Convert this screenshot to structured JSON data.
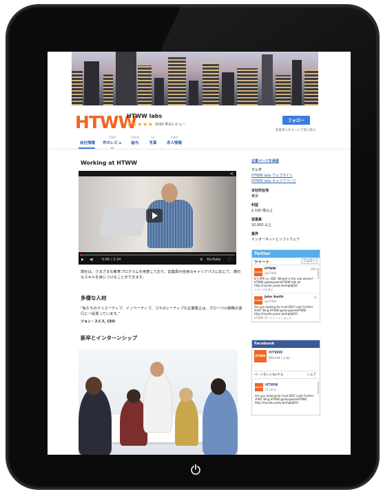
{
  "company": {
    "logo_text": "HTWW",
    "name": "HTWW labs",
    "stars": "★★★★★",
    "reviews": "5000 件のレビュー",
    "follow_label": "フォロー",
    "follow_note": "新着求人をメールで受け取る"
  },
  "tabs": [
    {
      "count": "",
      "label": "会社情報"
    },
    {
      "count": "5000",
      "label": "件のレビュー"
    },
    {
      "count": "10000",
      "label": "給与"
    },
    {
      "count": "10",
      "label": "写真"
    },
    {
      "count": "2000",
      "label": "求人情報"
    }
  ],
  "main": {
    "section_title": "Working at HTWW",
    "video_time": "0:00 / 2:24",
    "video_brand": "YouTube",
    "description": "弊社は、さまざまな教育プログラムを用意しており、従業員が自身のキャリアパスに応じて、適切なスキルを身につけることができます。",
    "diversity_title": "多様な人材",
    "quote": "“私たちのクリエーティブ、イノベーティブ、コラボレーティブな企業風土は、グローバル戦略の遂行に一役買っています。”",
    "author": "ジョン・スミス, CEO",
    "intern_title": "新卒とインターンシップ"
  },
  "sidebar": {
    "header_link": "企業ページを承認",
    "links_label": "リンク",
    "link1": "HTWW labs ウェブサイト",
    "link2": "HTWW labs キャリアページ",
    "hq_label": "本社所在地",
    "hq_value": "東京",
    "revenue_label": "利益",
    "revenue_value": "$ 100 億以上",
    "employees_label": "従業員",
    "employees_value": "10,000 以上",
    "industry_label": "業界",
    "industry_value": "インターネットとソフトウェア"
  },
  "twitter": {
    "title": "Twitter",
    "tweets_label": "ツイート",
    "follow_label": "フォロー",
    "tweet1": {
      "avatar": "HTWW",
      "name": "HTWW",
      "handle": "@HTWW",
      "time": "38m",
      "text": "It's APX vs. ADE. Whoah is the real winner? HTWW @ahoiyworkHTWW talk all http://mysite.youtu.be/hqfqB10",
      "retweet": "メディアを表示"
    },
    "tweet2": {
      "avatar": "HTWW",
      "name": "John Smith",
      "handle": "@HTWW",
      "time": "3h",
      "text": "Are you looking for trust IDX? Look Further #AET Bing HTWW @ahoiyworkHTWW http://mysite.youtu.be/hqfqB10",
      "retweet": "HTWW がリツイートしました"
    }
  },
  "facebook": {
    "title": "Facebook",
    "name": "HTWW",
    "likes": "999,144 いいね!",
    "like_label": "ページをいいね!する",
    "share_label": "シェア",
    "post": {
      "avatar": "HTWW",
      "name": "HTWW",
      "time": "21 mins",
      "text": "Are you looking for trust IDX? Look Further #AET Bing HTWW @ahoiyworkHTWW http://mysite.youtu.be/hqfqB10"
    }
  },
  "colors": {
    "brand": "#f26522",
    "link": "#2a5fa8",
    "button": "#3c7ddc",
    "twitter": "#55acee",
    "facebook": "#3b5998"
  }
}
